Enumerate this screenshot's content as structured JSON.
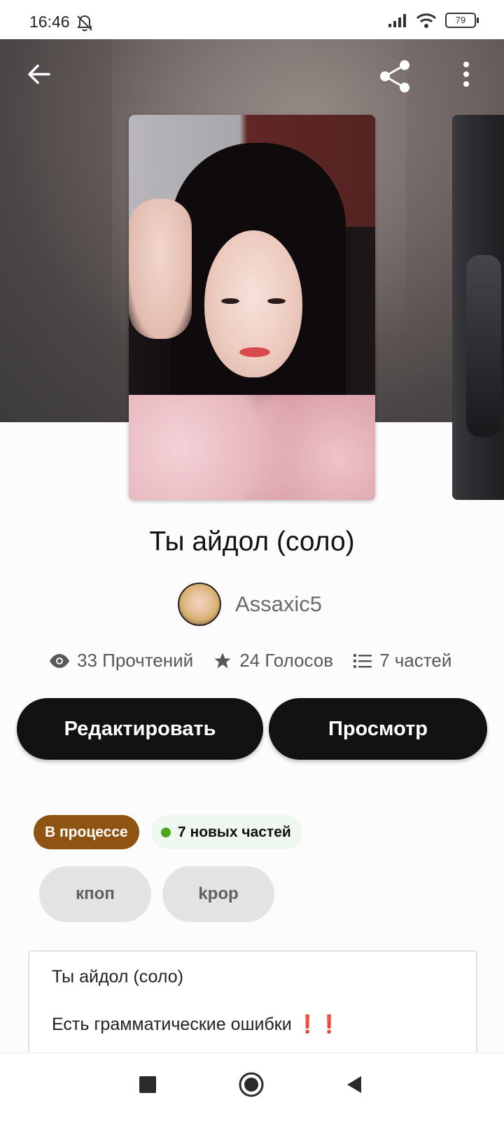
{
  "status_bar": {
    "time": "16:46",
    "battery": "79",
    "icons": [
      "bell-muted-icon",
      "signal-icon",
      "wifi-icon",
      "battery-icon"
    ]
  },
  "toolbar": {
    "icons": [
      "back-arrow-icon",
      "share-icon",
      "more-vert-icon"
    ]
  },
  "story": {
    "title": "Ты айдол (соло)",
    "author": "Assaxic5"
  },
  "stats": {
    "reads": "33 Прочтений",
    "votes": "24 Голосов",
    "parts": "7 частей"
  },
  "actions": {
    "edit_label": "Редактировать",
    "view_label": "Просмотр"
  },
  "badges": {
    "status": "В процессе",
    "new_parts": "7 новых частей"
  },
  "tags": [
    "кпоп",
    "kpop"
  ],
  "description": {
    "line1": "Ты айдол (соло)",
    "line2": "Есть грамматические ошибки",
    "line2_emoji": "❗❗"
  },
  "colors": {
    "button_bg": "#121113",
    "status_badge": "#8f5411",
    "new_dot": "#4da51b",
    "tag_bg": "#e4e2e4"
  },
  "nav": {
    "icons": [
      "recents-square-icon",
      "home-circle-icon",
      "back-triangle-icon"
    ]
  }
}
